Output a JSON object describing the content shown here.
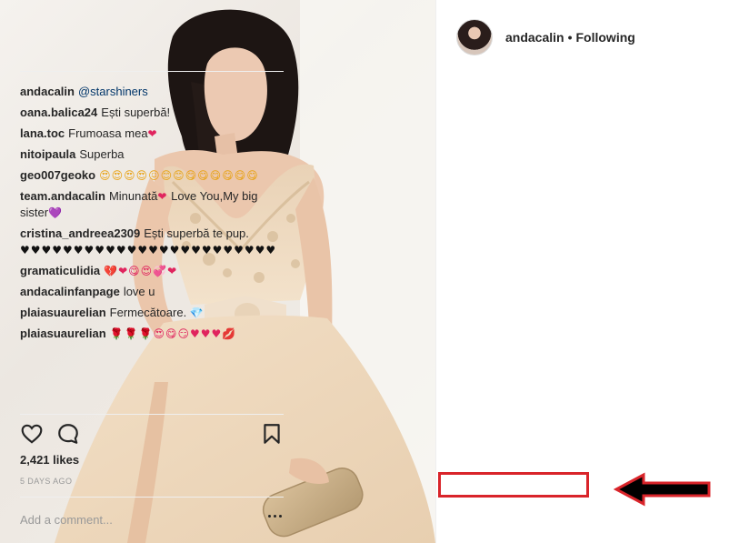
{
  "post": {
    "author": "andacalin",
    "follow_status": "Following",
    "separator": "•",
    "caption_user": "andacalin",
    "caption_mention": "@starshiners"
  },
  "comments": [
    {
      "user": "oana.balica24",
      "text": "Ești superbă!",
      "emoji": "❤"
    },
    {
      "user": "lana.toc",
      "text": "Frumoasa mea",
      "emoji": "❤"
    },
    {
      "user": "nitoipaula",
      "text": "Superba",
      "emoji": ""
    },
    {
      "user": "geo007geoko",
      "text": "",
      "emoji": "😍😍😍😍😖😊😊😋😋😋😋😋😋"
    },
    {
      "user": "team.andacalin",
      "text": "Minunată",
      "emoji": "❤",
      "text2": " Love You,My big sister",
      "emoji2": "💜"
    },
    {
      "user": "cristina_andreea2309",
      "text": "Ești superbă te pup.",
      "emoji": "♥♥♥♥♥♥♥♥♥♥♥♥♥♥♥♥♥♥♥♥♥♥♥♥"
    },
    {
      "user": "gramaticulidia",
      "text": "",
      "emoji": "💔❤😋😍💞❤"
    },
    {
      "user": "andacalinfanpage",
      "text": "love u",
      "emoji": ""
    },
    {
      "user": "plaiasuaurelian",
      "text": "Fermecătoare.",
      "emoji": "💎"
    },
    {
      "user": "plaiasuaurelian",
      "text": "",
      "emoji": "🌹🌹🌹😍😋😏♥♥♥💋"
    }
  ],
  "actions": {
    "like_icon": "heart-outline-icon",
    "comment_icon": "comment-bubble-icon",
    "save_icon": "bookmark-icon",
    "more_icon": "ellipsis-icon"
  },
  "likes": "2,421 likes",
  "timestamp": "5 DAYS AGO",
  "add_comment": {
    "placeholder": "Add a comment..."
  },
  "colors": {
    "annotation": "#d9242a",
    "mention": "#003569",
    "muted": "#999999"
  }
}
